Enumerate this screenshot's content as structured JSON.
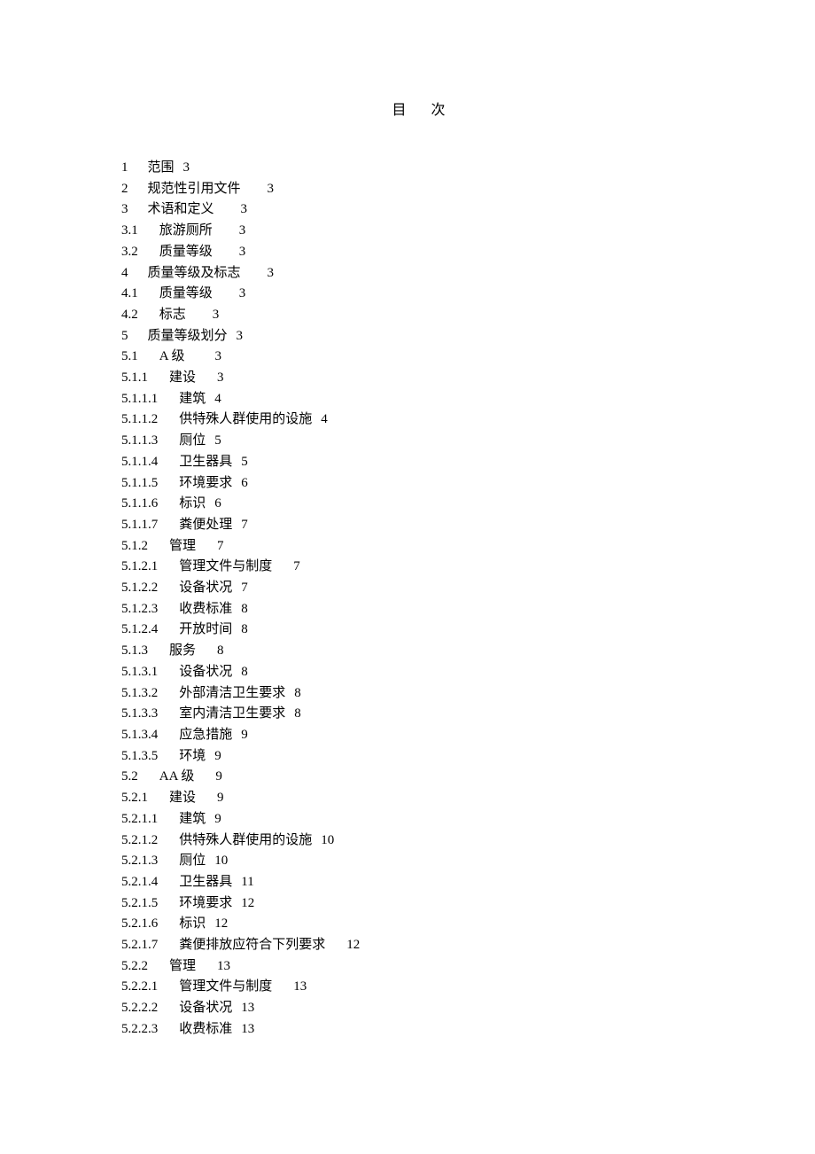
{
  "title": "目  次",
  "toc": [
    {
      "num": "1",
      "label": "范围",
      "page": "3",
      "gap1": "gap-wide",
      "gap2": "gap-sm"
    },
    {
      "num": "2",
      "label": "规范性引用文件",
      "page": "3",
      "gap1": "gap-wide",
      "gap2": "gap-big"
    },
    {
      "num": "3",
      "label": "术语和定义",
      "page": "3",
      "gap1": "gap-wide",
      "gap2": "gap-big"
    },
    {
      "num": "3.1",
      "label": "旅游厕所",
      "page": "3",
      "gap1": "gap-med",
      "gap2": "gap-big"
    },
    {
      "num": "3.2",
      "label": "质量等级",
      "page": "3",
      "gap1": "gap-med",
      "gap2": "gap-big"
    },
    {
      "num": "4",
      "label": "质量等级及标志",
      "page": "3",
      "gap1": "gap-wide",
      "gap2": "gap-big"
    },
    {
      "num": "4.1",
      "label": "质量等级",
      "page": "3",
      "gap1": "gap-med",
      "gap2": "gap-big"
    },
    {
      "num": "4.2",
      "label": "标志",
      "page": "3",
      "gap1": "gap-med",
      "gap2": "gap-big"
    },
    {
      "num": "5",
      "label": "质量等级划分",
      "page": "3",
      "gap1": "gap-wide",
      "gap2": "gap-sm"
    },
    {
      "num": "5.1",
      "label": "A 级",
      "page": "3",
      "gap1": "gap-med",
      "gap2": "gap-huge"
    },
    {
      "num": "5.1.1",
      "label": "建设",
      "page": "3",
      "gap1": "gap-med",
      "gap2": "gap-med"
    },
    {
      "num": "5.1.1.1",
      "label": "建筑",
      "page": "4",
      "gap1": "gap-med",
      "gap2": "gap-sm"
    },
    {
      "num": "5.1.1.2",
      "label": "供特殊人群使用的设施",
      "page": "4",
      "gap1": "gap-med",
      "gap2": "gap-sm"
    },
    {
      "num": "5.1.1.3",
      "label": "厕位",
      "page": "5",
      "gap1": "gap-med",
      "gap2": "gap-sm"
    },
    {
      "num": "5.1.1.4",
      "label": "卫生器具",
      "page": "5",
      "gap1": "gap-med",
      "gap2": "gap-sm"
    },
    {
      "num": "5.1.1.5",
      "label": "环境要求",
      "page": "6",
      "gap1": "gap-med",
      "gap2": "gap-sm"
    },
    {
      "num": "5.1.1.6",
      "label": "标识",
      "page": "6",
      "gap1": "gap-med",
      "gap2": "gap-sm"
    },
    {
      "num": "5.1.1.7",
      "label": "粪便处理",
      "page": "7",
      "gap1": "gap-med",
      "gap2": "gap-sm"
    },
    {
      "num": "5.1.2",
      "label": "管理",
      "page": "7",
      "gap1": "gap-med",
      "gap2": "gap-med"
    },
    {
      "num": "5.1.2.1",
      "label": "管理文件与制度",
      "page": "7",
      "gap1": "gap-med",
      "gap2": "gap-med"
    },
    {
      "num": "5.1.2.2",
      "label": "设备状况",
      "page": "7",
      "gap1": "gap-med",
      "gap2": "gap-sm"
    },
    {
      "num": "5.1.2.3",
      "label": "收费标准",
      "page": "8",
      "gap1": "gap-med",
      "gap2": "gap-sm"
    },
    {
      "num": "5.1.2.4",
      "label": "开放时间",
      "page": "8",
      "gap1": "gap-med",
      "gap2": "gap-sm"
    },
    {
      "num": "5.1.3",
      "label": "服务",
      "page": "8",
      "gap1": "gap-med",
      "gap2": "gap-med"
    },
    {
      "num": "5.1.3.1",
      "label": "设备状况",
      "page": "8",
      "gap1": "gap-med",
      "gap2": "gap-sm"
    },
    {
      "num": "5.1.3.2",
      "label": "外部清洁卫生要求",
      "page": "8",
      "gap1": "gap-med",
      "gap2": "gap-sm"
    },
    {
      "num": "5.1.3.3",
      "label": "室内清洁卫生要求",
      "page": "8",
      "gap1": "gap-med",
      "gap2": "gap-sm"
    },
    {
      "num": "5.1.3.4",
      "label": "应急措施",
      "page": "9",
      "gap1": "gap-med",
      "gap2": "gap-sm"
    },
    {
      "num": "5.1.3.5",
      "label": "环境",
      "page": "9",
      "gap1": "gap-med",
      "gap2": "gap-sm"
    },
    {
      "num": "5.2",
      "label": "AA 级",
      "page": "9",
      "gap1": "gap-med",
      "gap2": "gap-med"
    },
    {
      "num": "5.2.1",
      "label": "建设",
      "page": "9",
      "gap1": "gap-med",
      "gap2": "gap-med"
    },
    {
      "num": "5.2.1.1",
      "label": "建筑",
      "page": "9",
      "gap1": "gap-med",
      "gap2": "gap-sm"
    },
    {
      "num": "5.2.1.2",
      "label": "供特殊人群使用的设施",
      "page": "10",
      "gap1": "gap-med",
      "gap2": "gap-sm"
    },
    {
      "num": "5.2.1.3",
      "label": "厕位",
      "page": "10",
      "gap1": "gap-med",
      "gap2": "gap-sm"
    },
    {
      "num": "5.2.1.4",
      "label": "卫生器具",
      "page": "11",
      "gap1": "gap-med",
      "gap2": "gap-sm"
    },
    {
      "num": "5.2.1.5",
      "label": "环境要求",
      "page": "12",
      "gap1": "gap-med",
      "gap2": "gap-sm"
    },
    {
      "num": "5.2.1.6",
      "label": "标识",
      "page": "12",
      "gap1": "gap-med",
      "gap2": "gap-sm"
    },
    {
      "num": "5.2.1.7",
      "label": "粪便排放应符合下列要求",
      "page": "12",
      "gap1": "gap-med",
      "gap2": "gap-med"
    },
    {
      "num": "5.2.2",
      "label": "管理",
      "page": "13",
      "gap1": "gap-med",
      "gap2": "gap-med"
    },
    {
      "num": "5.2.2.1",
      "label": "管理文件与制度",
      "page": "13",
      "gap1": "gap-med",
      "gap2": "gap-med"
    },
    {
      "num": "5.2.2.2",
      "label": "设备状况",
      "page": "13",
      "gap1": "gap-med",
      "gap2": "gap-sm"
    },
    {
      "num": "5.2.2.3",
      "label": "收费标准",
      "page": "13",
      "gap1": "gap-med",
      "gap2": "gap-sm"
    }
  ]
}
